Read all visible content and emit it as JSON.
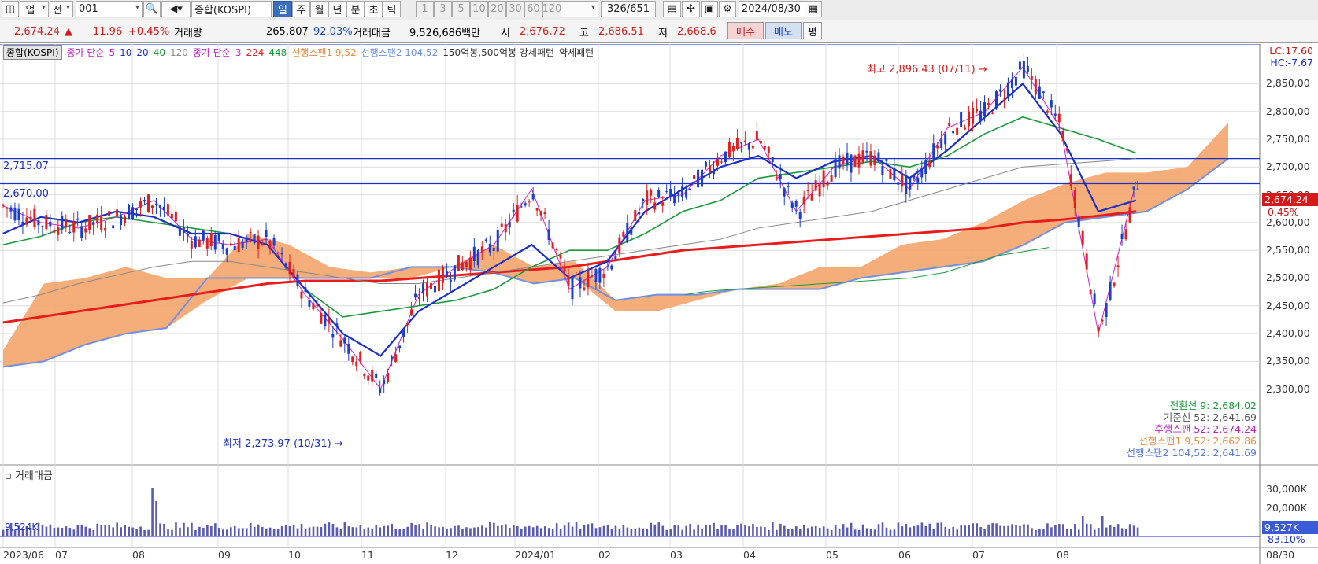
{
  "toolbar": {
    "type_label": "업",
    "prev_label": "전",
    "code_value": "001",
    "name_value": "종합(KOSPI)",
    "periods": [
      "일",
      "주",
      "월",
      "년",
      "분",
      "초",
      "틱"
    ],
    "active_period": "일",
    "intervals": [
      "1",
      "3",
      "5",
      "10",
      "20",
      "30",
      "60",
      "120"
    ],
    "page_count": "326/651",
    "date_value": "2024/08/30"
  },
  "infobar": {
    "index_value": "2,674.24",
    "change_arrow": "▲",
    "change_value": "11.96",
    "change_pct": "+0.45%",
    "volume_label": "거래량",
    "volume_value": "265,807",
    "volume_ratio": "92.03%",
    "amount_label": "거래대금",
    "amount_value": "9,526,686백만",
    "open_label": "시",
    "open_value": "2,676.72",
    "high_label": "고",
    "high_value": "2,686.51",
    "low_label": "저",
    "low_value": "2,668.6",
    "buy_label": "매수",
    "sell_label": "매도",
    "avg_label": "평"
  },
  "legend": {
    "name": "종합(KOSPI)",
    "ma_label": "종가 단순",
    "ma_periods": [
      "5",
      "10",
      "20",
      "40",
      "120"
    ],
    "ma2_label": "종가 단순",
    "ma2_periods": [
      "3",
      "224",
      "448"
    ],
    "span1": "선행스팬1 9,52",
    "span2": "선행스팬2 104,52",
    "pattern": "150억봉,500억봉 강세패턴",
    "weak": "약세패턴"
  },
  "annotations": {
    "high": "최고 2,896.43 (07/11)",
    "low": "최저 2,273.97 (10/31)",
    "line1": "2,715.07",
    "line2": "2,670.00",
    "lc": "LC:17.60",
    "hc": "HC:-7.67",
    "price_tag": "2,674.24",
    "pct_tag": "0.45%"
  },
  "ichimoku_values": [
    "전환선 9: 2,684.02",
    "기준선 52: 2,641.69",
    "후행스팬 52: 2,674.24",
    "선행스팬1 9,52: 2,662.86",
    "선행스팬2 104,52: 2,641.69"
  ],
  "volume": {
    "title": "거래대금",
    "left_value": "9,524K",
    "right_value": "9,527K",
    "right_pct": "83.10%"
  },
  "colors": {
    "up": "#e02020",
    "down": "#1a3fd0",
    "cloud": "#f4a56c",
    "cloud_neg": "#6f8fe8",
    "ma_blue": "#1a2ec8",
    "ma_green": "#1a9a3a",
    "ma_red": "#e81c1c"
  },
  "chart_data": {
    "type": "line",
    "title": "종합(KOSPI)",
    "y_ticks": [
      2850,
      2800,
      2750,
      2700,
      2650,
      2600,
      2550,
      2500,
      2450,
      2400,
      2350,
      2300
    ],
    "y_tick_labels": [
      "2,850,00",
      "2,800,00",
      "2,750,00",
      "2,700,00",
      "2,650,00",
      "2,600,00",
      "2,550,00",
      "2,500,00",
      "2,450,00",
      "2,400,00",
      "2,350,00",
      "2,300,00"
    ],
    "ylim": [
      2240,
      2920
    ],
    "x_labels": [
      "2023/06",
      "07",
      "08",
      "09",
      "10",
      "11",
      "12",
      "2024/01",
      "02",
      "03",
      "04",
      "05",
      "06",
      "07",
      "08",
      "08/30"
    ],
    "x": [
      "2023/06/01",
      "2023/06/15",
      "2023/07/01",
      "2023/07/15",
      "2023/08/01",
      "2023/08/15",
      "2023/09/01",
      "2023/09/15",
      "2023/10/01",
      "2023/10/15",
      "2023/11/01",
      "2023/11/15",
      "2023/12/01",
      "2023/12/15",
      "2024/01/01",
      "2024/01/15",
      "2024/02/01",
      "2024/02/15",
      "2024/03/01",
      "2024/03/15",
      "2024/04/01",
      "2024/04/15",
      "2024/05/01",
      "2024/05/15",
      "2024/06/01",
      "2024/06/15",
      "2024/07/01",
      "2024/07/15",
      "2024/08/01",
      "2024/08/15",
      "2024/08/30"
    ],
    "series": [
      {
        "name": "종합(KOSPI)",
        "values": [
          2630,
          2600,
          2590,
          2610,
          2640,
          2570,
          2560,
          2570,
          2470,
          2390,
          2300,
          2470,
          2520,
          2560,
          2660,
          2480,
          2520,
          2640,
          2650,
          2720,
          2750,
          2620,
          2700,
          2720,
          2660,
          2770,
          2800,
          2880,
          2770,
          2400,
          2674
        ]
      },
      {
        "name": "선행스팬1 9,52",
        "values": [
          2370,
          2490,
          2500,
          2520,
          2500,
          2460,
          2580,
          2560,
          2520,
          2510,
          2500,
          2520,
          2560,
          2520,
          2530,
          2440,
          2440,
          2460,
          2480,
          2490,
          2520,
          2520,
          2560,
          2570,
          2600,
          2640,
          2670,
          2690,
          2690,
          2700,
          2780
        ]
      },
      {
        "name": "선행스팬2 104,52",
        "values": [
          2340,
          2350,
          2380,
          2400,
          2410,
          2500,
          2500,
          2500,
          2500,
          2500,
          2520,
          2520,
          2510,
          2490,
          2500,
          2460,
          2470,
          2470,
          2480,
          2480,
          2480,
          2500,
          2510,
          2520,
          2530,
          2560,
          2600,
          2610,
          2620,
          2660,
          2715
        ]
      }
    ]
  }
}
